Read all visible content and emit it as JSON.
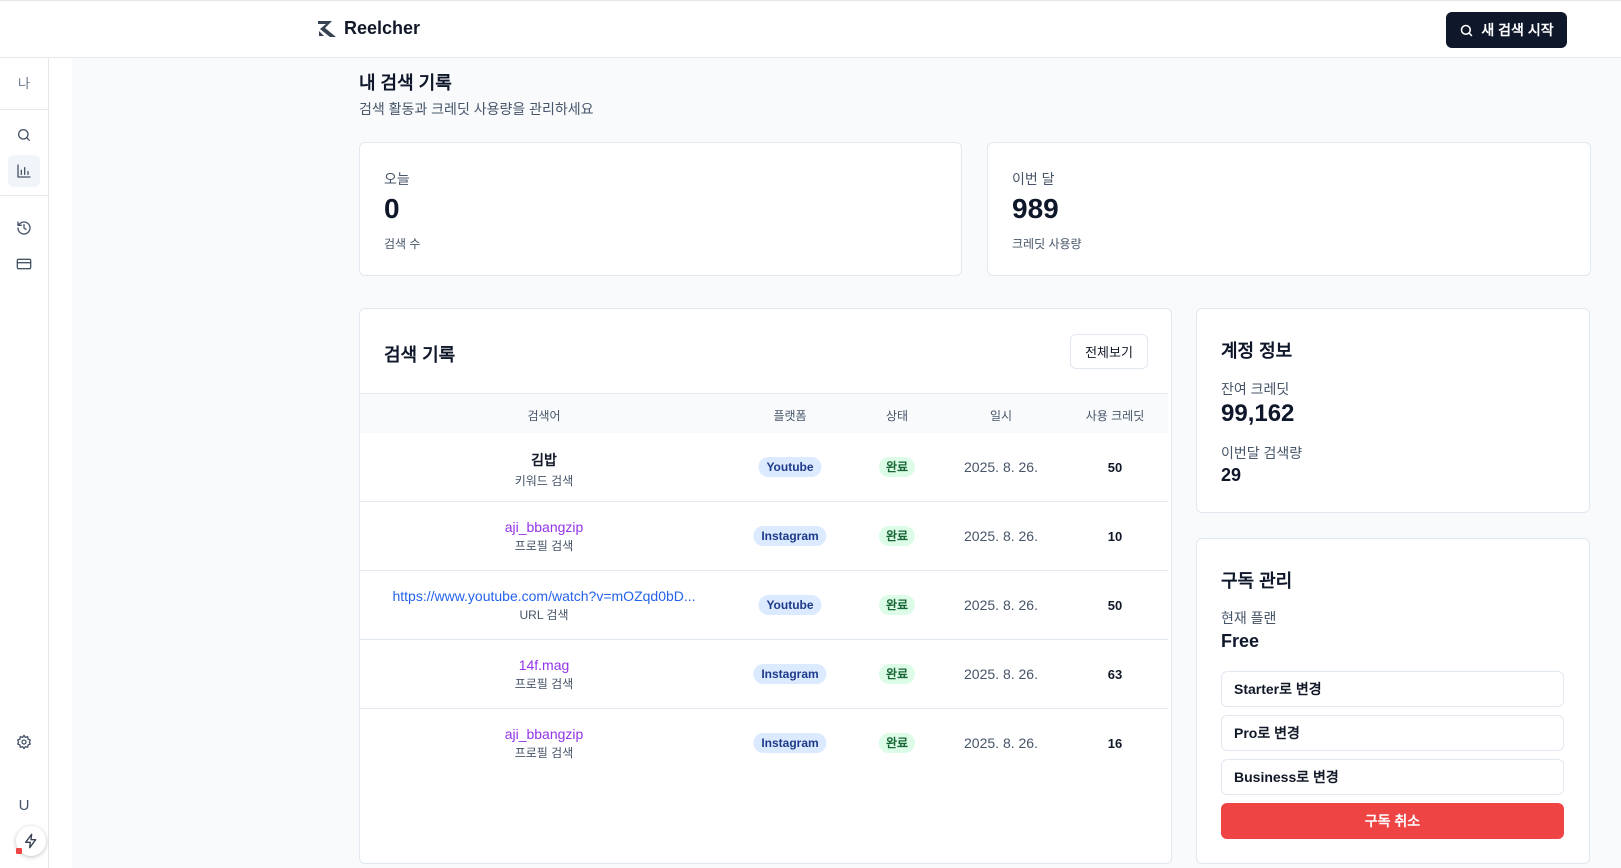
{
  "header": {
    "brand": "Reelcher",
    "new_search_label": "새 검색 시작"
  },
  "sidebar": {
    "me_label": "나",
    "user_initial": "U"
  },
  "page": {
    "title": "내 검색 기록",
    "subtitle": "검색 활동과 크레딧 사용량을 관리하세요"
  },
  "stats": {
    "today": {
      "label": "오늘",
      "value": "0",
      "foot": "검색 수"
    },
    "month": {
      "label": "이번 달",
      "value": "989",
      "foot": "크레딧 사용량"
    }
  },
  "history": {
    "title": "검색 기록",
    "view_all_label": "전체보기",
    "columns": [
      "검색어",
      "플랫폼",
      "상태",
      "일시",
      "사용 크레딧"
    ],
    "rows": [
      {
        "query": "김밥",
        "type": "키워드 검색",
        "platform": "Youtube",
        "status": "완료",
        "date": "2025. 8. 26.",
        "credits": "50"
      },
      {
        "query": "aji_bbangzip",
        "type": "프로필 검색",
        "platform": "Instagram",
        "status": "완료",
        "date": "2025. 8. 26.",
        "credits": "10"
      },
      {
        "query": "https://www.youtube.com/watch?v=mOZqd0bD...",
        "type": "URL 검색",
        "platform": "Youtube",
        "status": "완료",
        "date": "2025. 8. 26.",
        "credits": "50"
      },
      {
        "query": "14f.mag",
        "type": "프로필 검색",
        "platform": "Instagram",
        "status": "완료",
        "date": "2025. 8. 26.",
        "credits": "63"
      },
      {
        "query": "aji_bbangzip",
        "type": "프로필 검색",
        "platform": "Instagram",
        "status": "완료",
        "date": "2025. 8. 26.",
        "credits": "16"
      }
    ]
  },
  "account": {
    "title": "계정 정보",
    "remaining_label": "잔여 크레딧",
    "remaining_value": "99,162",
    "month_search_label": "이번달 검색량",
    "month_search_value": "29"
  },
  "subscription": {
    "title": "구독 관리",
    "plan_label": "현재 플랜",
    "plan_value": "Free",
    "options": [
      "Starter로 변경",
      "Pro로 변경",
      "Business로 변경"
    ],
    "cancel_label": "구독 취소"
  }
}
